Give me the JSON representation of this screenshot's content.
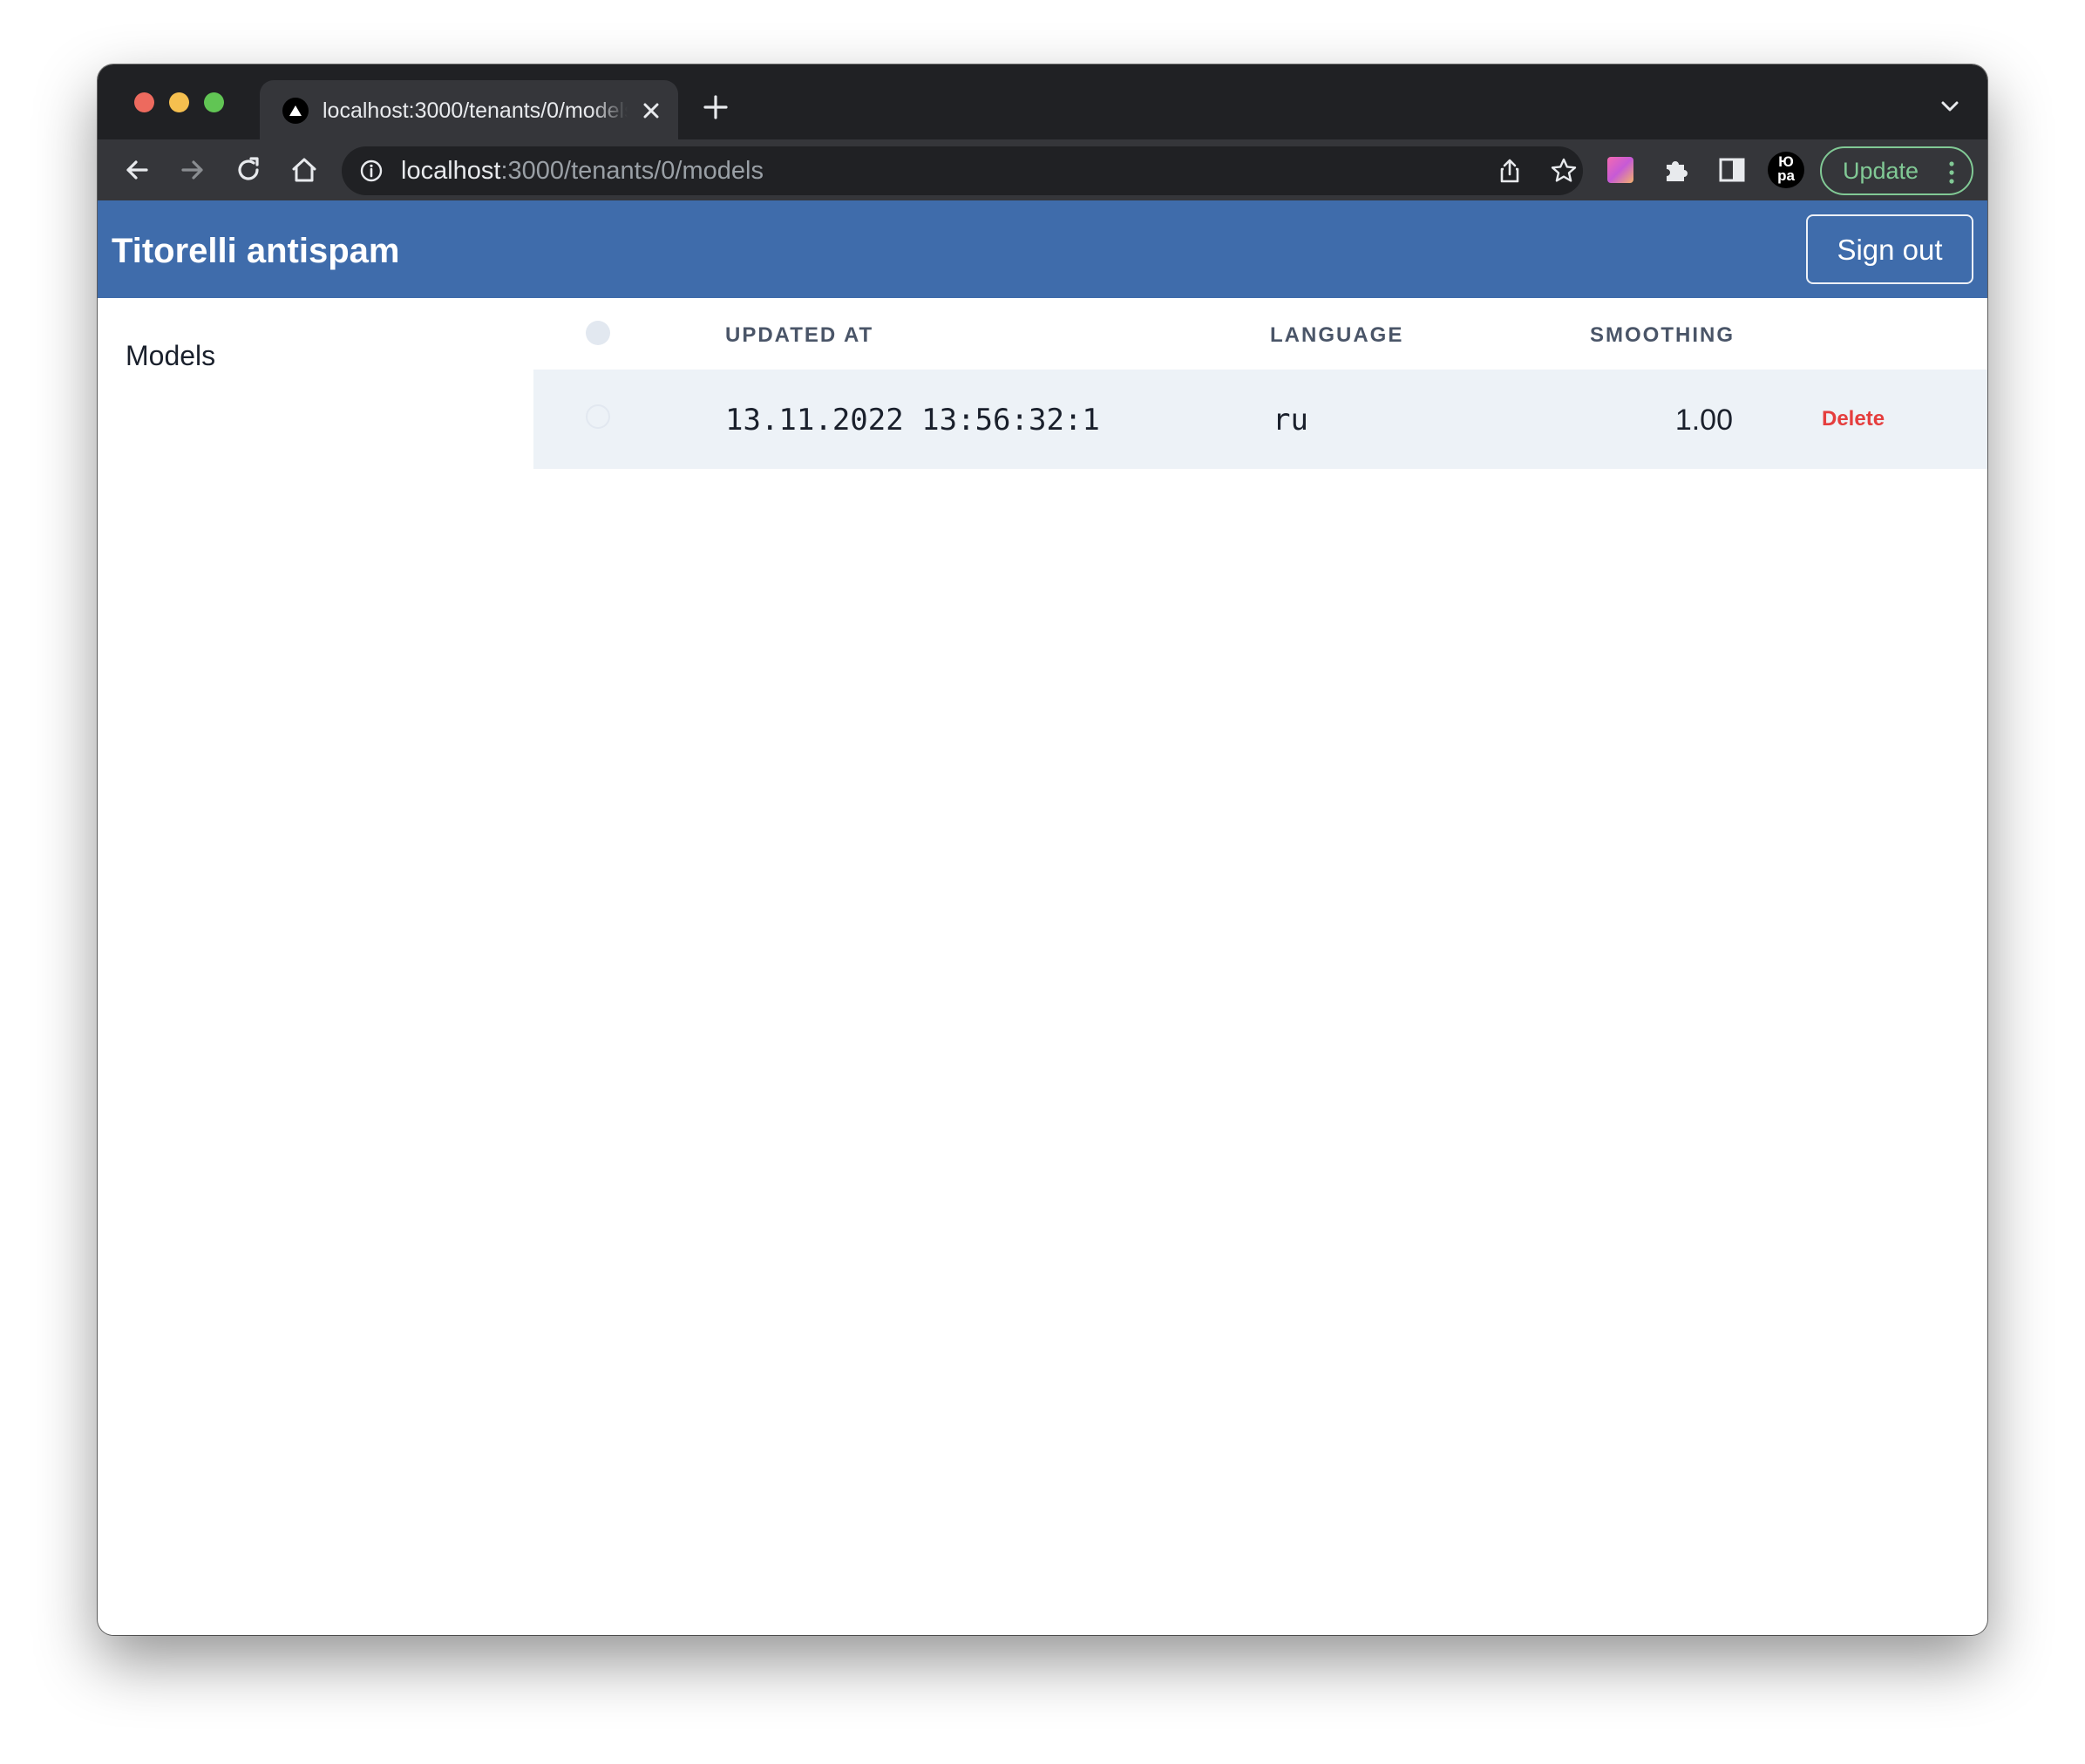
{
  "browser": {
    "tab_title": "localhost:3000/tenants/0/models",
    "url_host": "localhost",
    "url_rest": ":3000/tenants/0/models",
    "profile_line1": "Ю",
    "profile_line2": "ра",
    "update_label": "Update",
    "accent_update": "#81c995"
  },
  "app": {
    "title": "Titorelli antispam",
    "sign_out_label": "Sign out",
    "header_color": "#3f6cab"
  },
  "sidebar": {
    "items": [
      {
        "label": "Models"
      }
    ]
  },
  "table": {
    "columns": [
      {
        "label": "UPDATED AT"
      },
      {
        "label": "LANGUAGE"
      },
      {
        "label": "SMOOTHING"
      }
    ],
    "rows": [
      {
        "updated_at": "13.11.2022 13:56:32:1",
        "language": "ru",
        "smoothing": "1.00",
        "action_label": "Delete"
      }
    ]
  }
}
